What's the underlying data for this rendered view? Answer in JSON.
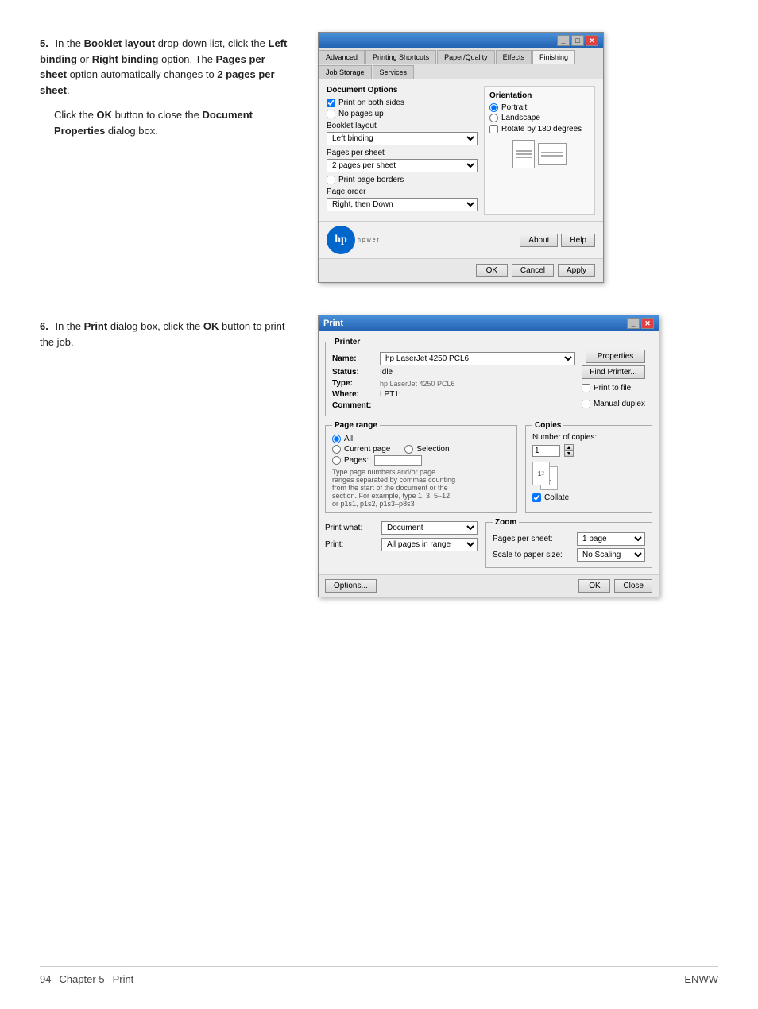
{
  "page": {
    "background": "#ffffff"
  },
  "steps": [
    {
      "number": "5.",
      "text_html": "In the <b>Booklet layout</b> drop-down list, click the <b>Left binding</b> or <b>Right binding</b> option. The <b>Pages per sheet</b> option automatically changes to <b>2 pages per sheet</b>.",
      "extra_html": "Click the <b>OK</b> button to close the <b>Document Properties</b> dialog box."
    },
    {
      "number": "6.",
      "text_html": "In the <b>Print</b> dialog box, click the <b>OK</b> button to print the job."
    }
  ],
  "doc_props_dialog": {
    "title": "",
    "tabs": [
      "Advanced",
      "Printing Shortcuts",
      "Paper/Quality",
      "Effects",
      "Finishing",
      "Job Storage",
      "Services"
    ],
    "active_tab": "Finishing",
    "document_options_label": "Document Options",
    "print_both_sides_label": "Print on both sides",
    "print_both_sides_checked": true,
    "no_pages_up_label": "No pages up",
    "booklet_layout_label": "Booklet layout",
    "left_binding_label": "Left binding",
    "pages_per_sheet_label": "Pages per sheet",
    "two_pages_label": "2 pages per sheet",
    "print_page_borders_label": "Print page borders",
    "page_order_label": "Page order",
    "right_then_down_label": "Right, then Down",
    "orientation_label": "Orientation",
    "portrait_label": "Portrait",
    "landscape_label": "Landscape",
    "rotate_label": "Rotate by 180 degrees",
    "about_btn": "About",
    "help_btn": "Help",
    "ok_btn": "OK",
    "cancel_btn": "Cancel",
    "apply_btn": "Apply"
  },
  "print_dialog": {
    "title": "Print",
    "printer_section": "Printer",
    "name_label": "Name:",
    "name_value": "hp LaserJet 4250 PCL6",
    "status_label": "Status:",
    "status_value": "Idle",
    "type_label": "Type:",
    "type_value": "hp LaserJet 4250 PCL6",
    "where_label": "Where:",
    "where_value": "LPT1:",
    "comment_label": "Comment:",
    "comment_value": "",
    "properties_btn": "Properties",
    "find_printer_btn": "Find Printer...",
    "print_to_file_label": "Print to file",
    "manual_duplex_label": "Manual duplex",
    "page_range_label": "Page range",
    "all_label": "All",
    "current_page_label": "Current page",
    "selection_label": "Selection",
    "pages_label": "Pages:",
    "pages_hint": "Type page numbers and/or page ranges separated by commas counting from the start of the document or the section. For example, type 1, 3, 5–12 or p1s1, p1s2, p1s3–p8s3",
    "copies_label": "Copies",
    "number_of_copies_label": "Number of copies:",
    "copies_value": "1",
    "collate_label": "Collate",
    "collate_checked": true,
    "print_what_label": "Print what:",
    "print_what_value": "Document",
    "print_label": "Print:",
    "print_value": "All pages in range",
    "zoom_label": "Zoom",
    "pages_per_sheet_label": "Pages per sheet:",
    "pages_per_sheet_value": "1 page",
    "scale_label": "Scale to paper size:",
    "scale_value": "No Scaling",
    "options_btn": "Options...",
    "ok_btn": "OK",
    "close_btn": "Close"
  },
  "footer": {
    "page_number": "94",
    "chapter": "Chapter 5",
    "section": "Print",
    "brand": "ENWW"
  }
}
